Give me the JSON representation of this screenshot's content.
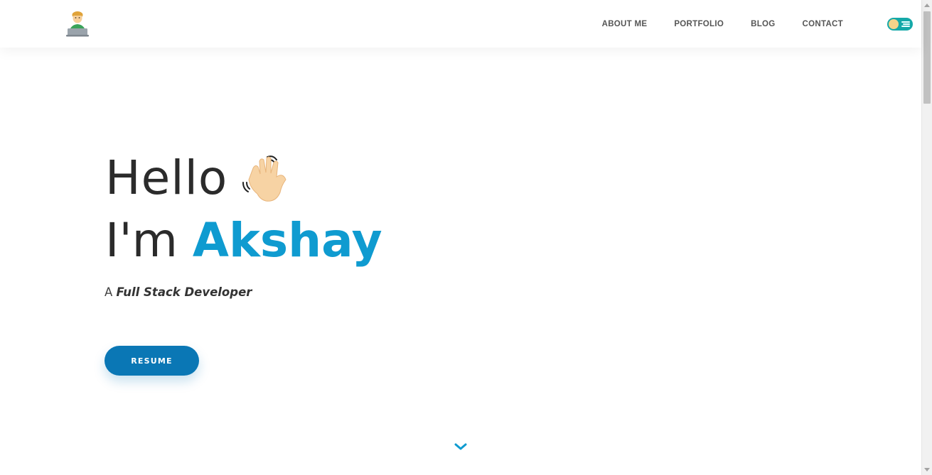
{
  "header": {
    "logo_icon": "developer-emoji-icon",
    "nav": {
      "items": [
        {
          "label": "ABOUT ME"
        },
        {
          "label": "PORTFOLIO"
        },
        {
          "label": "BLOG"
        },
        {
          "label": "CONTACT"
        }
      ]
    },
    "theme_toggle_icon": "theme-toggle-icon"
  },
  "hero": {
    "greeting": "Hello",
    "wave_icon": "waving-hand-icon",
    "intro_prefix": "I'm ",
    "name": "Akshay",
    "subtitle_prefix": "A ",
    "role": "Full Stack Developer",
    "resume_label": "RESUME",
    "scroll_icon": "chevron-down-icon"
  },
  "colors": {
    "accent": "#0f9bd0",
    "button": "#0a77b5",
    "toggle": "#14a8a8"
  }
}
